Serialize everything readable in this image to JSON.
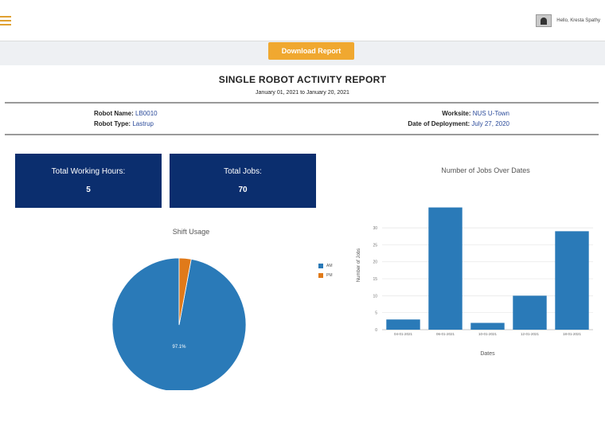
{
  "header": {
    "menu_icon": "hamburger-icon",
    "user_name": "Hello, Kresta Spathy"
  },
  "toolbar": {
    "download_label": "Download Report"
  },
  "report": {
    "title": "SINGLE ROBOT ACTIVITY REPORT",
    "date_range": "January 01, 2021 to January 20, 2021",
    "robot_name_label": "Robot Name:",
    "robot_name": "LB0010",
    "robot_type_label": "Robot Type:",
    "robot_type": "Lastrup",
    "worksite_label": "Worksite:",
    "worksite": "NUS U-Town",
    "deployment_label": "Date of Deployment:",
    "deployment_date": "July 27, 2020"
  },
  "kpis": {
    "hours_label": "Total Working Hours:",
    "hours_value": "5",
    "jobs_label": "Total Jobs:",
    "jobs_value": "70"
  },
  "colors": {
    "kpi_bg": "#0b2e6e",
    "series_blue": "#2a7ab8",
    "series_orange": "#e07a1a",
    "accent": "#f0a830"
  },
  "chart_data": [
    {
      "type": "pie",
      "title": "Shift Usage",
      "labels": [
        "AM",
        "PM"
      ],
      "values": [
        97.1,
        2.9
      ],
      "slice_labels": [
        "97.1%",
        ""
      ],
      "legend_placement": "right"
    },
    {
      "type": "bar",
      "title": "Number of Jobs Over Dates",
      "xlabel": "Dates",
      "ylabel": "Number of Jobs",
      "categories": [
        "04-01-2021",
        "06-01-2021",
        "10-01-2021",
        "12-01-2021",
        "18-01-2021"
      ],
      "values": [
        3,
        36,
        2,
        10,
        29
      ],
      "yticks": [
        "0",
        "5",
        "10",
        "15",
        "20",
        "25",
        "30"
      ],
      "ylim": [
        0,
        38
      ],
      "grid": true
    }
  ]
}
